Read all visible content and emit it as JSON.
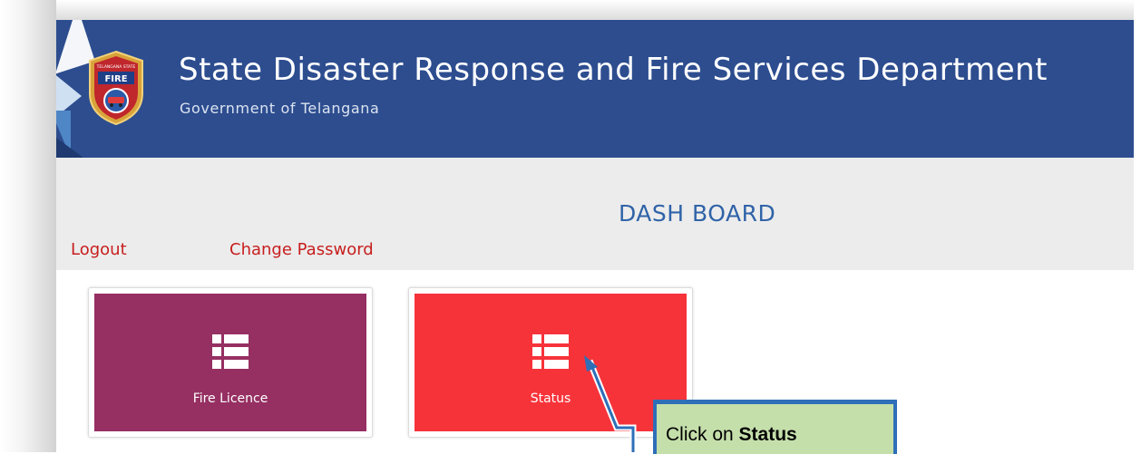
{
  "header": {
    "title": "State Disaster Response and Fire Services Department",
    "subtitle": "Government of Telangana",
    "logo_text": "FIRE",
    "logo_ring_text": "TELANGANA STATE"
  },
  "dashboard": {
    "title": "DASH BOARD",
    "logout_label": "Logout",
    "change_password_label": "Change Password"
  },
  "tiles": [
    {
      "label": "Fire Licence",
      "icon": "list-icon",
      "color": "#962f62"
    },
    {
      "label": "Status",
      "icon": "list-icon",
      "color": "#f7333a"
    }
  ],
  "callout": {
    "prefix": "Click on ",
    "target": "Status"
  },
  "colors": {
    "header_bg": "#2d4d8f",
    "band_bg": "#ececec",
    "link": "#c81e1e",
    "dash_title": "#2f63a8",
    "callout_bg": "#c5dfab",
    "callout_border": "#2e6fb8"
  }
}
